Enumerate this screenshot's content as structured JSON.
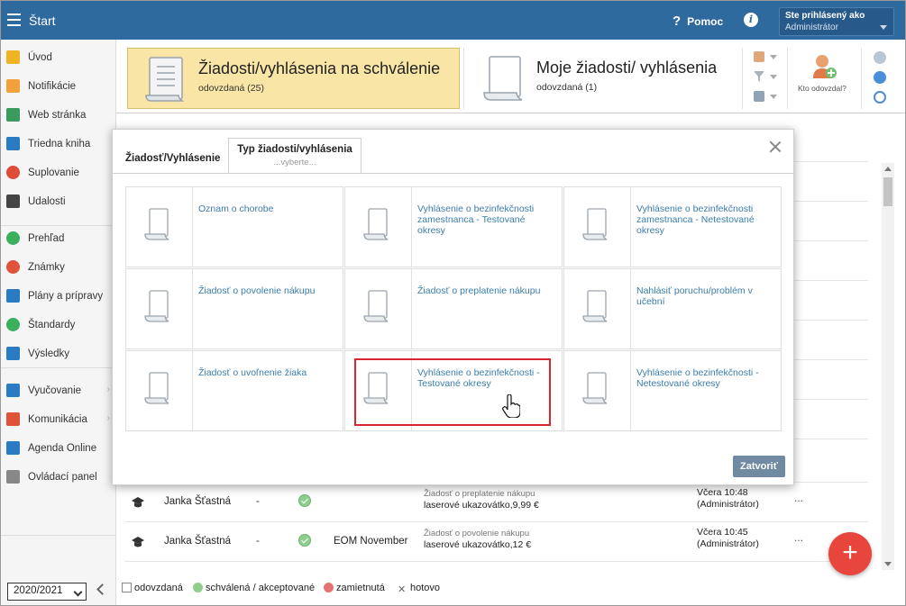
{
  "topbar": {
    "app_title": "Štart",
    "help_label": "Pomoc",
    "help_symbol": "?",
    "info_symbol": "i",
    "user_line1": "Ste prihlásený ako",
    "user_line2": "Administrátor"
  },
  "sidebar": {
    "items": [
      {
        "label": "Úvod",
        "icon": "star-icon",
        "color": "#f0b323"
      },
      {
        "label": "Notifikácie",
        "icon": "envelope-icon",
        "color": "#f0a13a"
      },
      {
        "label": "Web stránka",
        "icon": "home-icon",
        "color": "#3a9b5c"
      },
      {
        "label": "Triedna kniha",
        "icon": "book-icon",
        "color": "#2b7bc4"
      },
      {
        "label": "Suplovanie",
        "icon": "user-swap-icon",
        "color": "#e04b3a"
      },
      {
        "label": "Udalosti",
        "icon": "calendar-icon",
        "color": "#444444"
      },
      {
        "label": "Prehľad",
        "icon": "check-circle-icon",
        "color": "#3aaf5c"
      },
      {
        "label": "Známky",
        "icon": "grade-icon",
        "color": "#e0523a"
      },
      {
        "label": "Plány a prípravy",
        "icon": "briefcase-icon",
        "color": "#2b7bc4"
      },
      {
        "label": "Štandardy",
        "icon": "shield-check-icon",
        "color": "#3aaf5c"
      },
      {
        "label": "Výsledky",
        "icon": "bar-chart-icon",
        "color": "#2b7bc4"
      },
      {
        "label": "Vyučovanie",
        "icon": "open-book-icon",
        "color": "#2b7bc4"
      },
      {
        "label": "Komunikácia",
        "icon": "chat-icon",
        "color": "#e0523a"
      },
      {
        "label": "Agenda Online",
        "icon": "pen-icon",
        "color": "#2b7bc4"
      },
      {
        "label": "Ovládací panel",
        "icon": "gear-icon",
        "color": "#888888"
      }
    ],
    "year": "2020/2021"
  },
  "header": {
    "card1_title": "Žiadosti/vyhlásenia na schválenie",
    "card1_sub": "odovzdaná (25)",
    "card2_title": "Moje žiadosti/ vyhlásenia",
    "card2_sub": "odovzdaná (1)",
    "who_label": "Kto odovzdal?"
  },
  "list": {
    "rows": [
      {
        "name": "Janka Šťastná",
        "dash": "-",
        "col3": "",
        "r1": "Žiadosť o preplatenie nákupu",
        "r2": "laserové ukazovátko,9,99 €",
        "t1": "Včera 10:48",
        "t2": "(Administrátor)",
        "more": "..."
      },
      {
        "name": "Janka Šťastná",
        "dash": "-",
        "col3": "EOM November",
        "r1": "Žiadosť o povolenie nákupu",
        "r2": "laserové ukazovátko,12 €",
        "t1": "Včera 10:45",
        "t2": "(Administrátor)",
        "more": "..."
      }
    ]
  },
  "legend": {
    "submitted": "odovzdaná",
    "approved": "schválená / akceptované",
    "rejected": "zamietnutá",
    "done": "hotovo"
  },
  "fab_symbol": "+",
  "modal": {
    "tab1": "Žiadosť/Vyhlásenie",
    "tab2": "Typ žiadosti/vyhlásenia",
    "tab2_sub": "...vyberte...",
    "tiles": [
      "Oznam o chorobe",
      "Vyhlásenie o bezinfekčnosti zamestnanca - Testované okresy",
      "Vyhlásenie o bezinfekčnosti zamestnanca - Netestované okresy",
      "Žiadosť o povolenie nákupu",
      "Žiadosť o preplatenie nákupu",
      "Nahlásiť poruchu/problém v učební",
      "Žiadosť o uvoľnenie žiaka",
      "Vyhlásenie o bezinfekčnosti - Testované okresy",
      "Vyhlásenie o bezinfekčnosti - Netestované okresy"
    ],
    "close_button": "Zatvoriť"
  }
}
